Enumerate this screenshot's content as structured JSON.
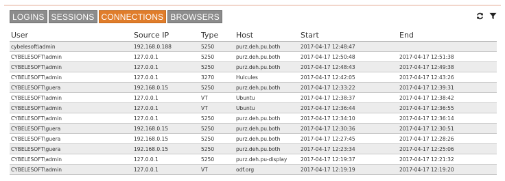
{
  "tabs": [
    {
      "label": "LOGINS",
      "active": false
    },
    {
      "label": "SESSIONS",
      "active": false
    },
    {
      "label": "CONNECTIONS",
      "active": true
    },
    {
      "label": "BROWSERS",
      "active": false
    }
  ],
  "toolbar": {
    "refresh_icon": "refresh-icon",
    "filter_icon": "filter-icon"
  },
  "colors": {
    "accent": "#e07d2b",
    "tab_bg": "#8c8c8c",
    "row_alt": "#ececec"
  },
  "table": {
    "headers": [
      "User",
      "Source IP",
      "Type",
      "Host",
      "Start",
      "End"
    ],
    "rows": [
      [
        "cybelesoft\\admin",
        "192.168.0.188",
        "5250",
        "purz.deh.pu.both",
        "2017-04-17 12:48:47",
        ""
      ],
      [
        "CYBELESOFT\\admin",
        "127.0.0.1",
        "5250",
        "purz.deh.pu.both",
        "2017-04-17 12:50:48",
        "2017-04-17 12:51:38"
      ],
      [
        "CYBELESOFT\\admin",
        "127.0.0.1",
        "5250",
        "purz.deh.pu.both",
        "2017-04-17 12:48:43",
        "2017-04-17 12:49:38"
      ],
      [
        "CYBELESOFT\\admin",
        "127.0.0.1",
        "3270",
        "Hulcules",
        "2017-04-17 12:42:05",
        "2017-04-17 12:43:26"
      ],
      [
        "CYBELESOFT\\guera",
        "192.168.0.15",
        "5250",
        "purz.deh.pu.both",
        "2017-04-17 12:33:22",
        "2017-04-17 12:39:31"
      ],
      [
        "CYBELESOFT\\admin",
        "127.0.0.1",
        "VT",
        "Ubuntu",
        "2017-04-17 12:38:37",
        "2017-04-17 12:38:42"
      ],
      [
        "CYBELESOFT\\admin",
        "127.0.0.1",
        "VT",
        "Ubuntu",
        "2017-04-17 12:36:44",
        "2017-04-17 12:36:55"
      ],
      [
        "CYBELESOFT\\admin",
        "127.0.0.1",
        "5250",
        "purz.deh.pu.both",
        "2017-04-17 12:34:10",
        "2017-04-17 12:36:14"
      ],
      [
        "CYBELESOFT\\guera",
        "192.168.0.15",
        "5250",
        "purz.deh.pu.both",
        "2017-04-17 12:30:36",
        "2017-04-17 12:30:51"
      ],
      [
        "CYBELESOFT\\guera",
        "192.168.0.15",
        "5250",
        "purz.deh.pu.both",
        "2017-04-17 12:27:45",
        "2017-04-17 12:28:26"
      ],
      [
        "CYBELESOFT\\guera",
        "192.168.0.15",
        "5250",
        "purz.deh.pu.both",
        "2017-04-17 12:23:34",
        "2017-04-17 12:25:06"
      ],
      [
        "CYBELESOFT\\admin",
        "127.0.0.1",
        "5250",
        "purz.deh.pu-display",
        "2017-04-17 12:19:37",
        "2017-04-17 12:21:32"
      ],
      [
        "CYBELESOFT\\admin",
        "127.0.0.1",
        "VT",
        "odf.org",
        "2017-04-17 12:19:19",
        "2017-04-17 12:19:20"
      ]
    ]
  }
}
